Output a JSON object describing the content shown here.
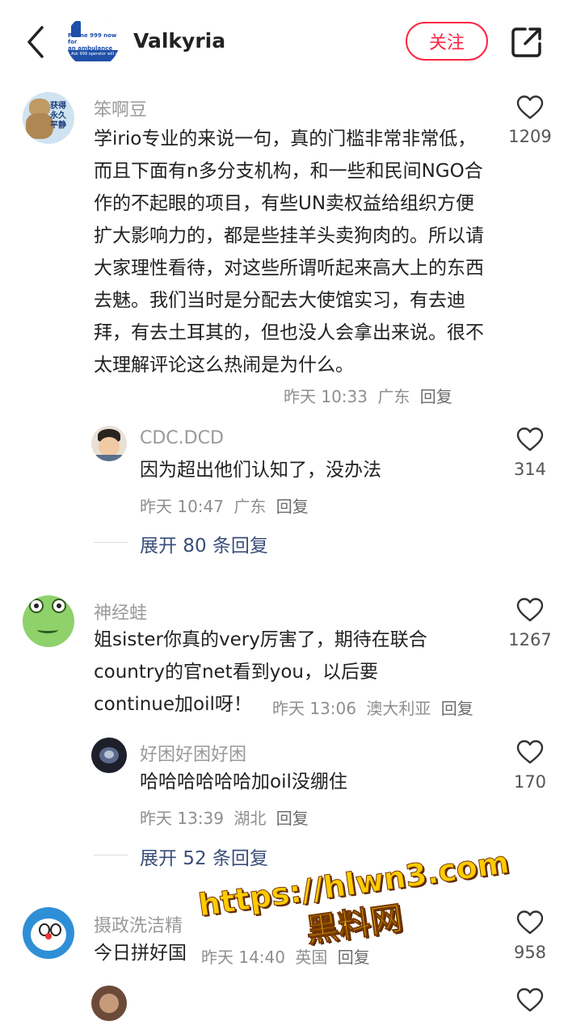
{
  "header": {
    "back_icon": "chevron-left-icon",
    "author_name": "Valkyria",
    "avatar_text_1": "Phone 999 now for",
    "avatar_text_2": "an ambulance",
    "avatar_text_3": "Ask 999 operator will ask",
    "follow_label": "关注",
    "share_icon": "share-icon",
    "accent_color": "#ff2442"
  },
  "comments": [
    {
      "user": "笨啊豆",
      "avatar_badge": "获得永久平静",
      "text": "学irio专业的来说一句，真的门槛非常非常低，而且下面有n多分支机构，和一些和民间NGO合作的不起眼的项目，有些UN卖权益给组织方便扩大影响力的，都是些挂羊头卖狗肉的。所以请大家理性看待，对这些所谓听起来高大上的东西去魅。我们当时是分配去大使馆实习，有去迪拜，有去土耳其的，但也没人会拿出来说。很不太理解评论这么热闹是为什么。",
      "time": "昨天 10:33",
      "location": "广东",
      "reply_label": "回复",
      "likes": "1209",
      "replies": [
        {
          "user": "CDC.DCD",
          "text": "因为超出他们认知了，没办法",
          "time": "昨天 10:47",
          "location": "广东",
          "reply_label": "回复",
          "likes": "314"
        }
      ],
      "expand_label": "展开 80 条回复"
    },
    {
      "user": "神经蛙",
      "text_lines": [
        "姐sister你真的very厉害了，期待在联合",
        "country的官net看到you，以后要",
        "continue加oil呀！"
      ],
      "time": "昨天 13:06",
      "location": "澳大利亚",
      "reply_label": "回复",
      "likes": "1267",
      "replies": [
        {
          "user": "好困好困好困",
          "text": "哈哈哈哈哈哈加oil没绷住",
          "time": "昨天 13:39",
          "location": "湖北",
          "reply_label": "回复",
          "likes": "170"
        }
      ],
      "expand_label": "展开 52 条回复"
    },
    {
      "user": "摄政洗洁精",
      "text": "今日拼好国",
      "time": "昨天 14:40",
      "location": "英国",
      "reply_label": "回复",
      "likes": "958"
    }
  ],
  "watermark": {
    "line1": "https://hlwn3.com",
    "line2": "黑料网"
  },
  "icons": {
    "like": "heart-outline-icon"
  }
}
